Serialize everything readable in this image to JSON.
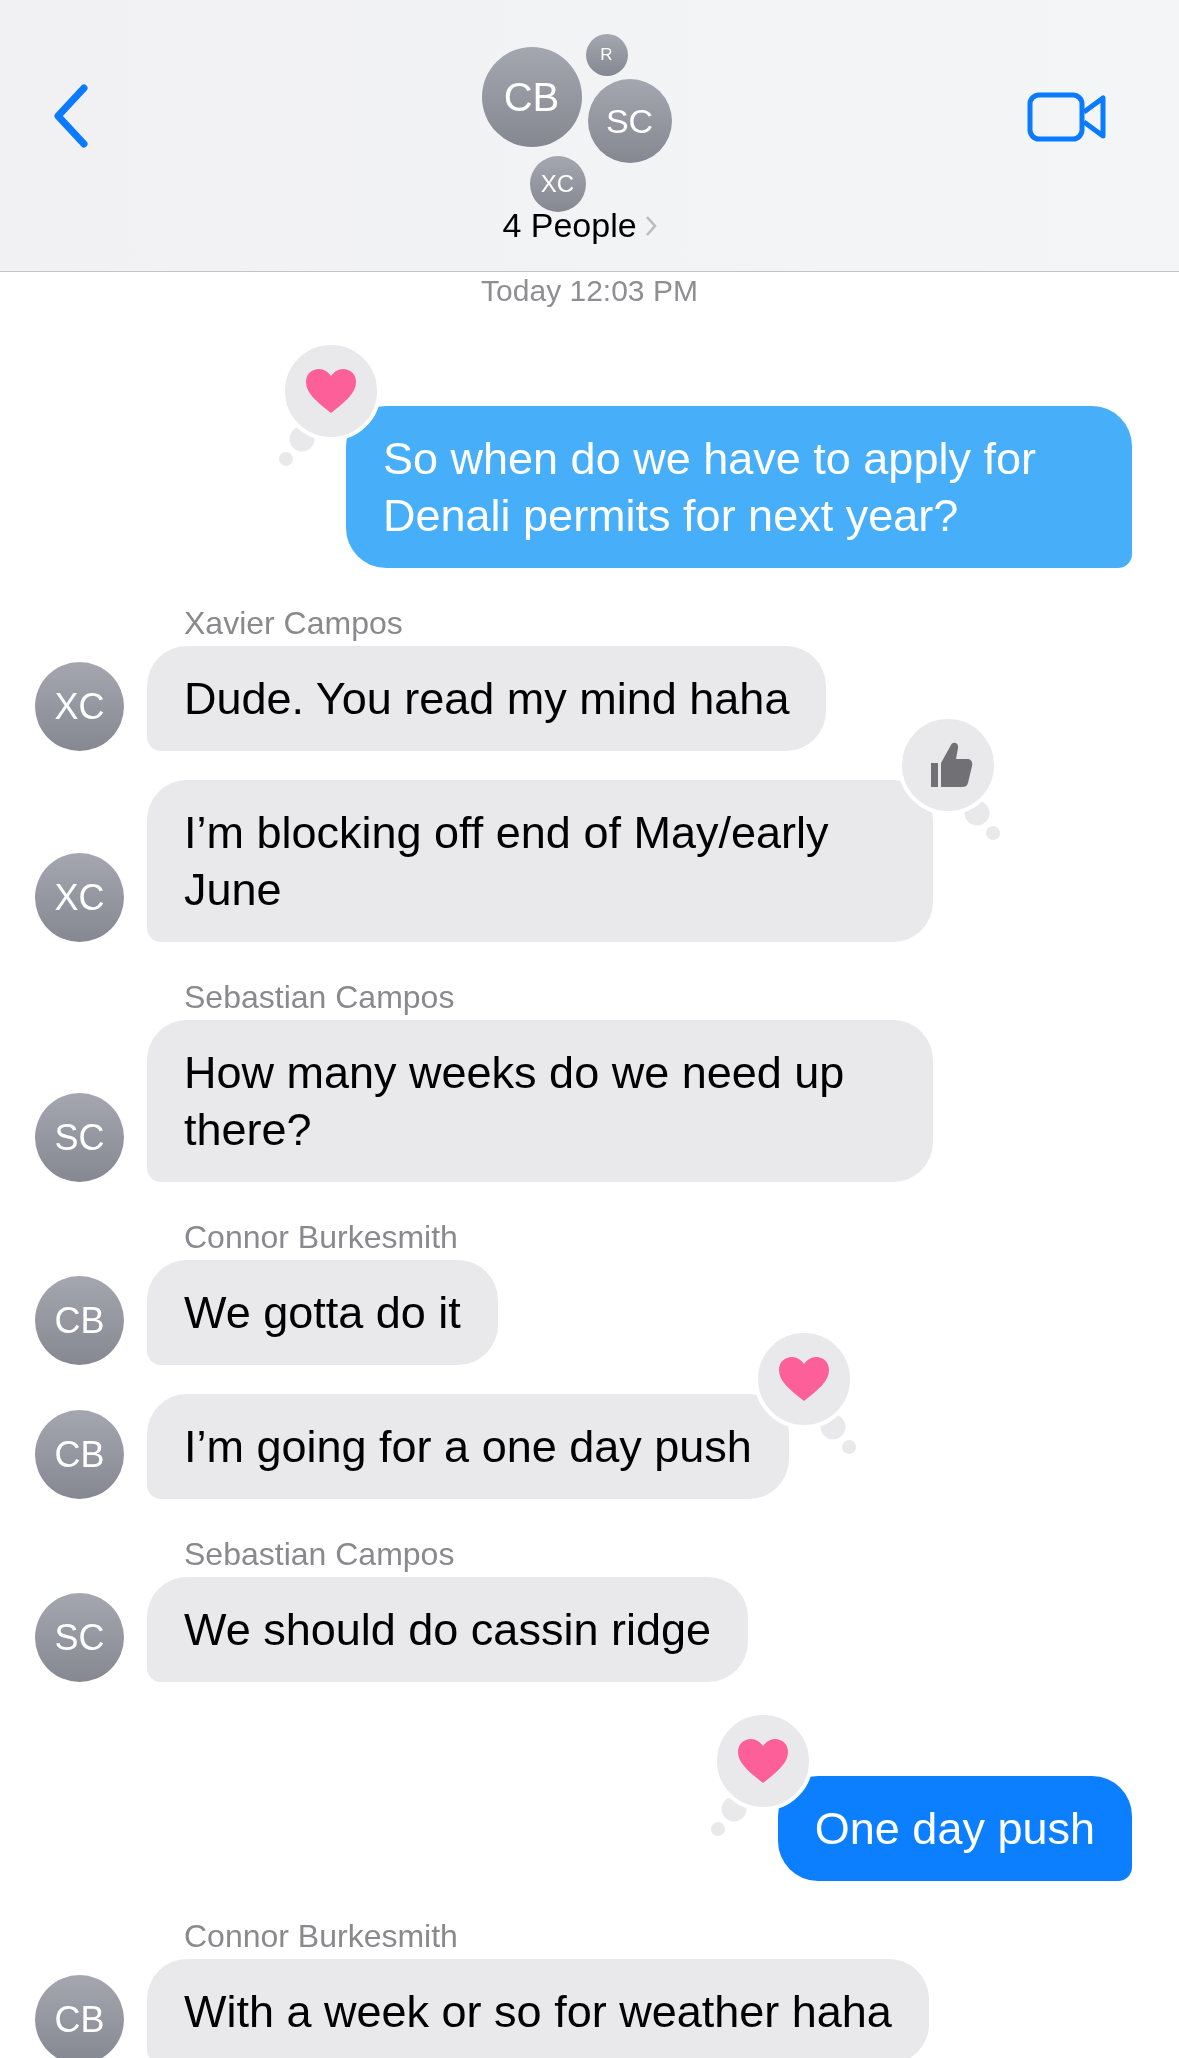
{
  "header": {
    "avatars": [
      {
        "initials": "CB"
      },
      {
        "initials": "R"
      },
      {
        "initials": "SC"
      },
      {
        "initials": "XC"
      }
    ],
    "title": "4 People"
  },
  "timestamp": "Today 12:03 PM",
  "messages": [
    {
      "kind": "sent",
      "text": "So when do we have to apply for Denali permits for next year?",
      "color": "#47aefa",
      "reaction": {
        "kind": "heart"
      }
    },
    {
      "kind": "received",
      "sender": "Xavier Campos",
      "avatar": "XC",
      "text": "Dude. You read my mind haha"
    },
    {
      "kind": "received",
      "avatar": "XC",
      "text": "I’m blocking off end of May/early June",
      "reaction": {
        "kind": "thumbs"
      }
    },
    {
      "kind": "received",
      "sender": "Sebastian Campos",
      "avatar": "SC",
      "text": "How many weeks do we need up there?"
    },
    {
      "kind": "received",
      "sender": "Connor Burkesmith",
      "avatar": "CB",
      "text": "We gotta do it"
    },
    {
      "kind": "received",
      "avatar": "CB",
      "text": "I’m going for a one day push",
      "reaction": {
        "kind": "heart"
      }
    },
    {
      "kind": "received",
      "sender": "Sebastian Campos",
      "avatar": "SC",
      "text": "We should do cassin ridge"
    },
    {
      "kind": "sent",
      "text": "One day push",
      "color": "#0b7fff",
      "reaction": {
        "kind": "heart"
      }
    },
    {
      "kind": "received",
      "sender": "Connor Burkesmith",
      "avatar": "CB",
      "text": "With a week or so for weather haha"
    }
  ]
}
